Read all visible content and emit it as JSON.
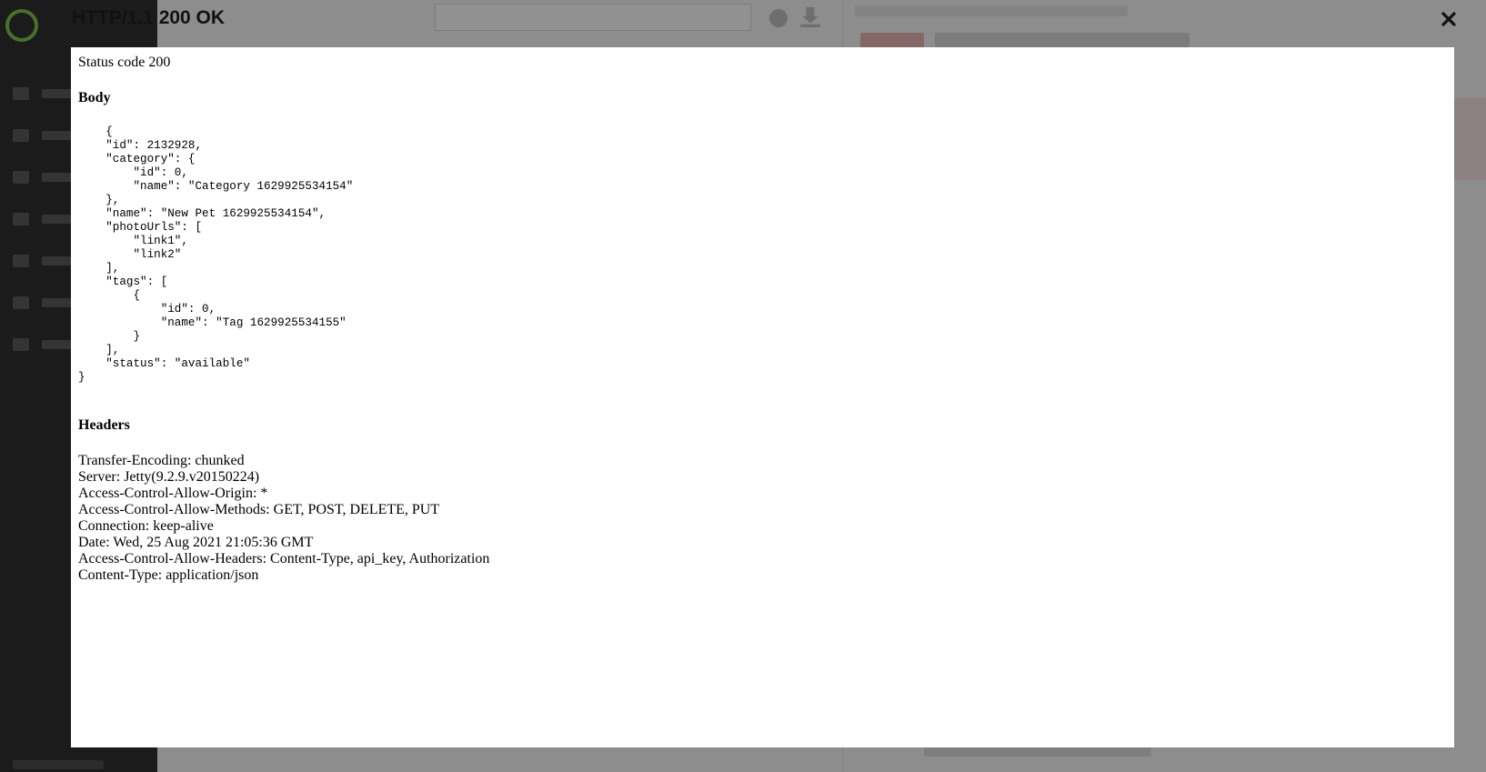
{
  "modal": {
    "title": "HTTP/1.1 200 OK",
    "status_line": "Status code 200",
    "body_heading": "Body",
    "body_json": "    {\n    \"id\": 2132928,\n    \"category\": {\n        \"id\": 0,\n        \"name\": \"Category 1629925534154\"\n    },\n    \"name\": \"New Pet 1629925534154\",\n    \"photoUrls\": [\n        \"link1\",\n        \"link2\"\n    ],\n    \"tags\": [\n        {\n            \"id\": 0,\n            \"name\": \"Tag 1629925534155\"\n        }\n    ],\n    \"status\": \"available\"\n}",
    "headers_heading": "Headers",
    "headers": [
      "Transfer-Encoding: chunked",
      "Server: Jetty(9.2.9.v20150224)",
      "Access-Control-Allow-Origin: *",
      "Access-Control-Allow-Methods: GET, POST, DELETE, PUT",
      "Connection: keep-alive",
      "Date: Wed, 25 Aug 2021 21:05:36 GMT",
      "Access-Control-Allow-Headers: Content-Type, api_key, Authorization",
      "Content-Type: application/json"
    ],
    "close_icon": "close-icon"
  },
  "colors": {
    "overlay": "rgba(0,0,0,0.42)",
    "modal_background": "#ffffff",
    "title_text": "#111111"
  }
}
